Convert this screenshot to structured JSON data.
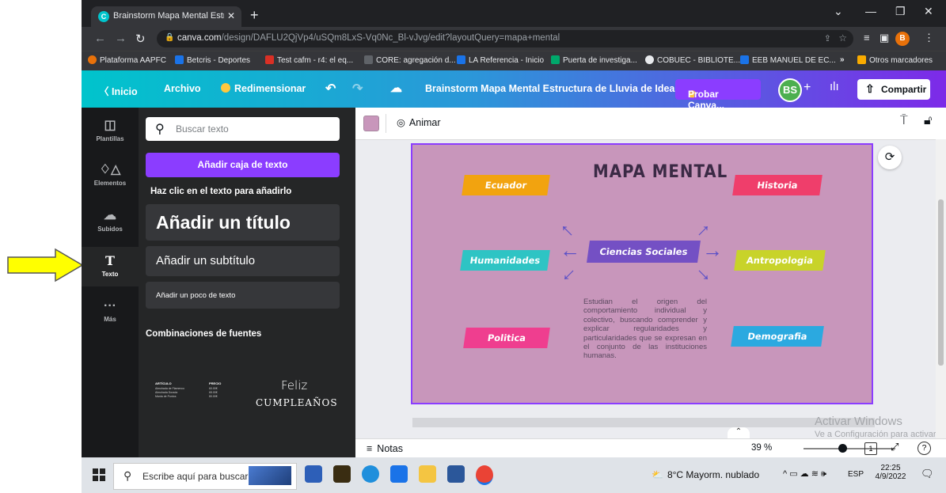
{
  "browser": {
    "tab_title": "Brainstorm Mapa Mental Estructu",
    "url_main": "canva.com",
    "url_rest": "/design/DAFLU2QjVp4/uSQm8LxS-Vq0Nc_Bl-vJvg/edit?layoutQuery=mapa+mental",
    "bookmarks": [
      {
        "label": "Plataforma AAPFC",
        "color": "#e8710a"
      },
      {
        "label": "Betcris - Deportes",
        "color": "#1a73e8"
      },
      {
        "label": "Test cafm - r4: el eq...",
        "color": "#d93025"
      },
      {
        "label": "CORE: agregación d...",
        "color": "#5f6368"
      },
      {
        "label": "LA Referencia - Inicio",
        "color": "#1a73e8"
      },
      {
        "label": "Puerta de investiga...",
        "color": "#00a86b"
      },
      {
        "label": "COBUEC - BIBLIOTE...",
        "color": "#e8eaed"
      },
      {
        "label": "EEB MANUEL DE EC...",
        "color": "#1a73e8"
      }
    ],
    "more_bookmarks": "Otros marcadores",
    "profile_initial": "B"
  },
  "canva": {
    "inicio": "Inicio",
    "archivo": "Archivo",
    "redimensionar": "Redimensionar",
    "doc_title": "Brainstorm Mapa Mental Estructura de Lluvia de Idea...",
    "probar": "Probar Canva...",
    "user_initials": "BS",
    "compartir": "Compartir",
    "animar": "Animar",
    "notas": "Notas",
    "zoom": "39 %",
    "page_number": "1"
  },
  "rail": [
    {
      "label": "Plantillas",
      "icon": "template-icon"
    },
    {
      "label": "Elementos",
      "icon": "elements-icon"
    },
    {
      "label": "Subidos",
      "icon": "upload-icon"
    },
    {
      "label": "Texto",
      "icon": "text-icon"
    },
    {
      "label": "Más",
      "icon": "more-icon"
    }
  ],
  "panel": {
    "search_placeholder": "Buscar texto",
    "add_textbox": "Añadir caja de texto",
    "hint": "Haz clic en el texto para añadirlo",
    "add_title": "Añadir un título",
    "add_subtitle": "Añadir un subtítulo",
    "add_body": "Añadir un poco de texto",
    "combos_heading": "Combinaciones de fuentes",
    "combo1": {
      "col1_head": "ARTÍCULO",
      "col2_head": "PRECIO",
      "items": [
        "Almohada de Flamenco",
        "Almohada Dorada",
        "Manta de Puntos"
      ],
      "prices": [
        "60.00€",
        "65.00€",
        "80.00€"
      ]
    },
    "combo2": {
      "line1": "Feliz",
      "line2": "CUMPLEAÑOS"
    }
  },
  "mindmap": {
    "title": "MAPA MENTAL",
    "center": "Ciencias Sociales",
    "nodes": [
      {
        "label": "Ecuador",
        "color": "#f2a30f"
      },
      {
        "label": "Historia",
        "color": "#ef3e6b"
      },
      {
        "label": "Humanidades",
        "color": "#2ec4c4"
      },
      {
        "label": "Antropologia",
        "color": "#c8d32a"
      },
      {
        "label": "Politica",
        "color": "#ef3e8f"
      },
      {
        "label": "Demografia",
        "color": "#2ba9e0"
      }
    ],
    "paragraph": "Estudian el origen del comportamiento individual y colectivo, buscando comprender y explicar regularidades y particularidades que se expresan en el conjunto de las instituciones humanas."
  },
  "windows_watermark": {
    "line1": "Activar Windows",
    "line2": "Ve a Configuración para activar Windows."
  },
  "taskbar": {
    "search_placeholder": "Escribe aquí para buscar",
    "weather": "8°C  Mayorm. nublado",
    "lang": "ESP",
    "time": "22:25",
    "date": "4/9/2022"
  }
}
